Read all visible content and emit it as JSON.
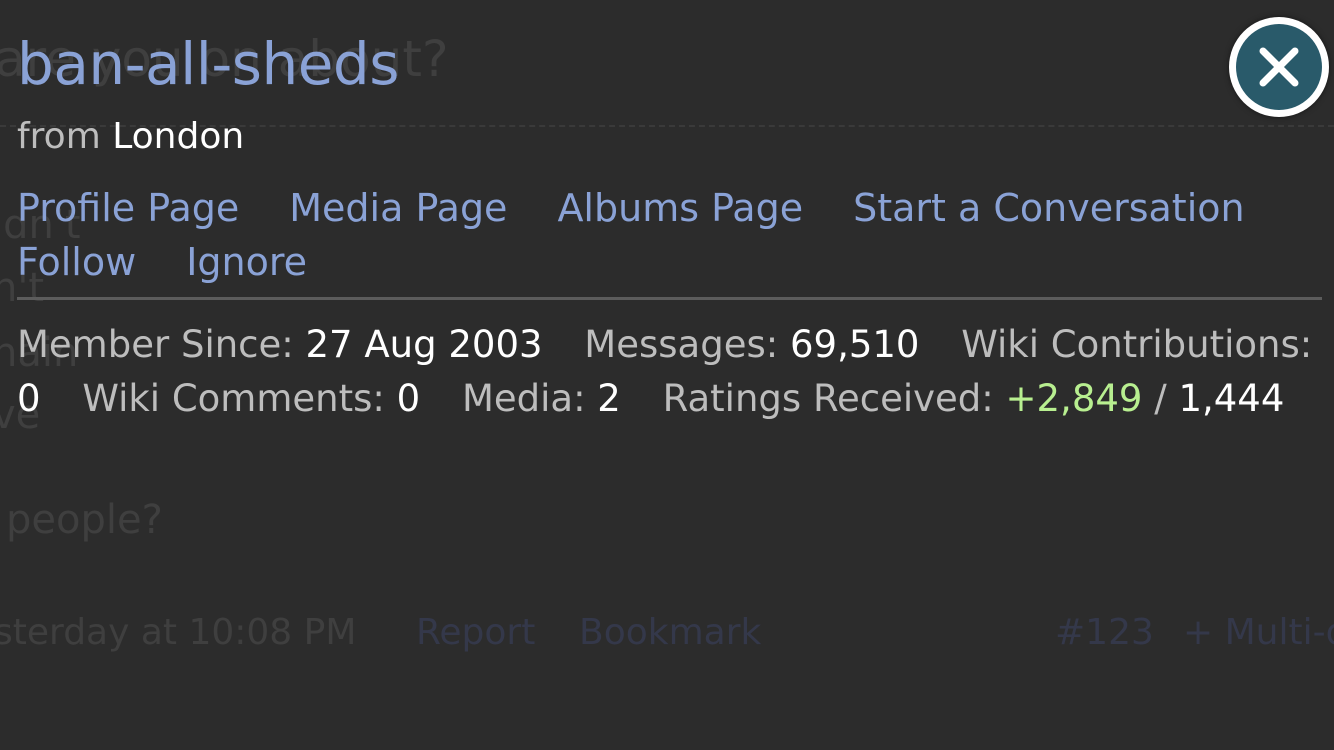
{
  "background": {
    "heading": "are you on about?",
    "fragments": [
      "ldn't",
      "n't",
      "nain",
      "ve"
    ],
    "people": "people?",
    "footer": {
      "timestamp": "sterday at 10:08 PM",
      "report": "Report",
      "bookmark": "Bookmark",
      "post_number": "#123",
      "multi": "+ Multi-q"
    }
  },
  "profile": {
    "username": "ban-all-sheds",
    "from_label": "from",
    "location": "London"
  },
  "links": {
    "profile_page": "Profile Page",
    "media_page": "Media Page",
    "albums_page": "Albums Page",
    "start_conversation": "Start a Conversation",
    "follow": "Follow",
    "ignore": "Ignore"
  },
  "stats": {
    "member_since_label": "Member Since:",
    "member_since_value": "27 Aug 2003",
    "messages_label": "Messages:",
    "messages_value": "69,510",
    "wiki_contrib_label": "Wiki Contributions:",
    "wiki_contrib_value": "0",
    "wiki_comments_label": "Wiki Comments:",
    "wiki_comments_value": "0",
    "media_label": "Media:",
    "media_value": "2",
    "ratings_label": "Ratings Received:",
    "ratings_positive": "+2,849",
    "ratings_separator": "/",
    "ratings_total": "1,444"
  },
  "colors": {
    "link": "#8aa2d6",
    "positive": "#b8ef90",
    "close_fill": "#295a6a"
  },
  "icons": {
    "close": "close-icon"
  }
}
